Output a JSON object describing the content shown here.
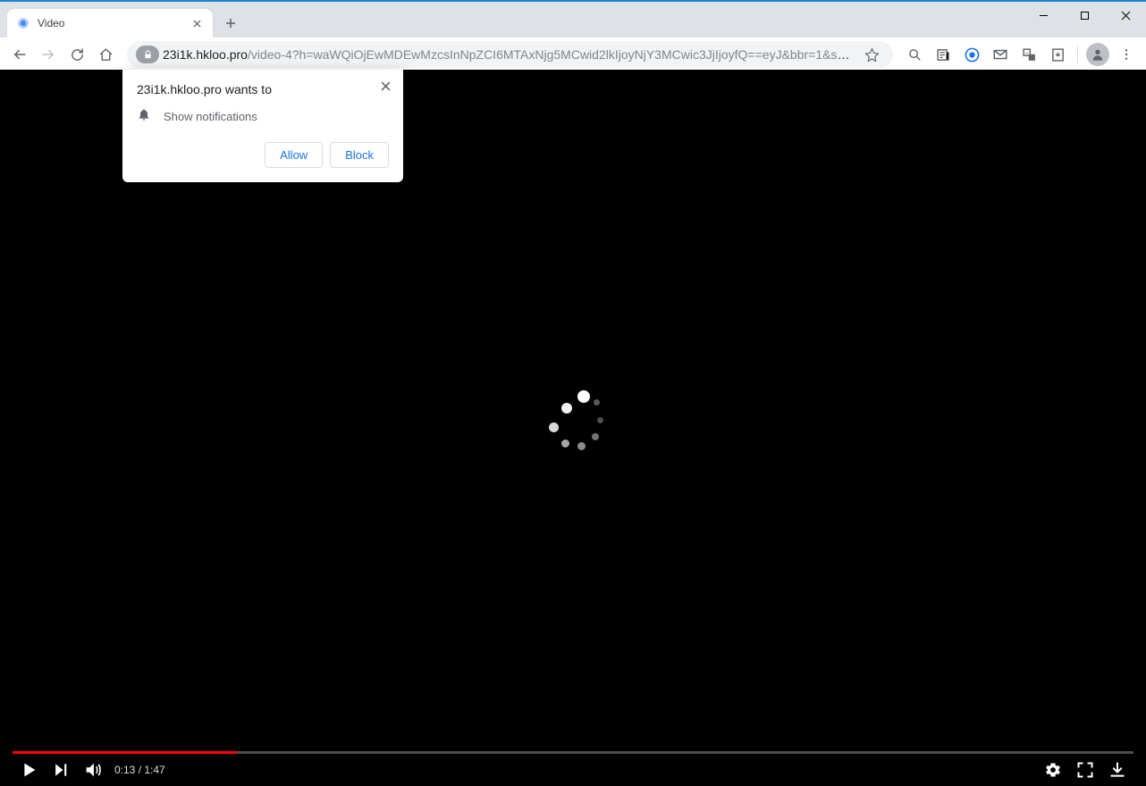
{
  "tab": {
    "title": "Video"
  },
  "url": {
    "host": "23i1k.hkloo.pro",
    "path": "/video-4?h=waWQiOjEwMDEwMzcsInNpZCI6MTAxNjg5MCwid2lkIjoyNjY3MCwic3JjIjoyfQ==eyJ&bbr=1&si1=..."
  },
  "permission": {
    "origin": "23i1k.hkloo.pro wants to",
    "request": "Show notifications",
    "allow": "Allow",
    "block": "Block"
  },
  "video": {
    "current": "0:13",
    "separator": " / ",
    "duration": "1:47",
    "progress_pct": 20
  }
}
